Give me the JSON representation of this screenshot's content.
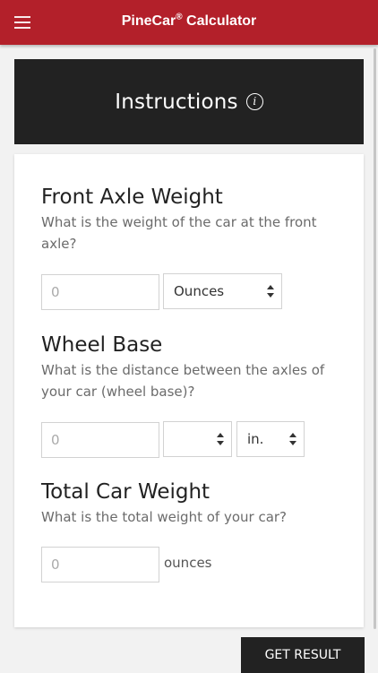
{
  "header": {
    "title": "PineCar",
    "title_mark": "®",
    "title_suffix": " Calculator",
    "menu_icon": "hamburger-menu-icon",
    "color": "#b3202a"
  },
  "instructions": {
    "label": "Instructions",
    "icon": "info-icon",
    "icon_glyph": "i"
  },
  "front_axle": {
    "title": "Front Axle Weight",
    "question": "What is the weight of the car at the front axle?",
    "input_placeholder": "0",
    "unit_selected": "Ounces"
  },
  "wheel_base": {
    "title": "Wheel Base",
    "question": "What is the distance between the axles of your car (wheel base)?",
    "input_placeholder": "0",
    "fraction_selected": "",
    "unit_selected": "in."
  },
  "total_weight": {
    "title": "Total Car Weight",
    "question": "What is the total weight of your car?",
    "input_placeholder": "0",
    "suffix": "ounces"
  },
  "actions": {
    "get_result": "GET RESULT"
  }
}
